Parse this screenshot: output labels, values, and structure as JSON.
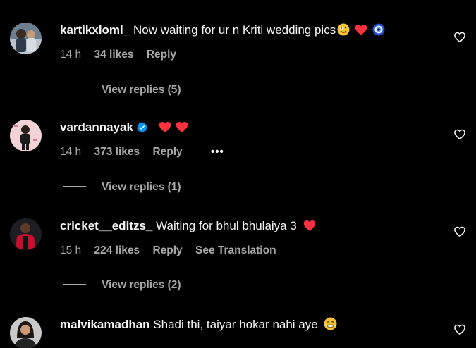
{
  "comments": [
    {
      "username": "kartikxloml_",
      "text": "Now waiting for ur n Kriti wedding pics",
      "emojis": [
        "zany-face-emoji",
        "red-heart-emoji",
        "nazar-amulet-emoji"
      ],
      "time": "14 h",
      "likes": "34 likes",
      "reply": "Reply",
      "view_replies": "View replies (5)"
    },
    {
      "username": "vardannayak",
      "verified": true,
      "text": "",
      "emojis": [
        "red-heart-emoji",
        "red-heart-emoji"
      ],
      "time": "14 h",
      "likes": "373 likes",
      "reply": "Reply",
      "more": "•••",
      "view_replies": "View replies (1)"
    },
    {
      "username": "cricket__editzs_",
      "text": "Waiting for bhul bhulaiya 3",
      "emojis": [
        "red-heart-emoji"
      ],
      "time": "15 h",
      "likes": "224 likes",
      "reply": "Reply",
      "translation": "See Translation",
      "view_replies": "View replies (2)"
    },
    {
      "username": "malvikamadhan",
      "text": "Shadi thi, taiyar hokar nahi aye",
      "emojis": [
        "face-with-steam-emoji"
      ]
    }
  ],
  "colors": {
    "background": "#000000",
    "primary_text": "#f5f5f5",
    "secondary_text": "#a8a8a8",
    "verified_blue": "#0095f6",
    "heart_red": "#ff3040"
  }
}
